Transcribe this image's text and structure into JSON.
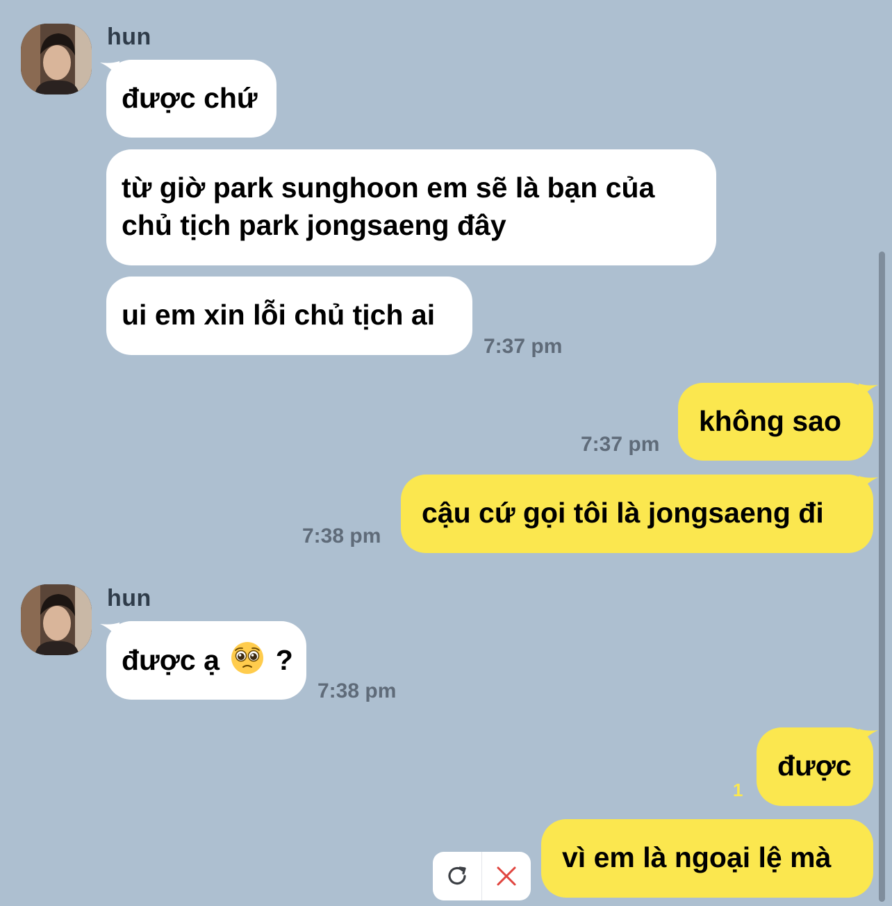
{
  "colors": {
    "background": "#adbfd0",
    "incoming_bubble": "#ffffff",
    "outgoing_bubble": "#fbe74f",
    "timestamp": "#5f6b79",
    "unread_count": "#fbe74f",
    "delete": "#e0453f"
  },
  "groups": [
    {
      "sender": "hun",
      "avatar_icon": "profile-photo",
      "messages": [
        {
          "text": "được chứ"
        },
        {
          "text_lines": [
            "từ giờ park sunghoon em sẽ là bạn của",
            "chủ tịch park jongsaeng đây"
          ]
        },
        {
          "text": "ui em xin lỗi chủ tịch ai",
          "time": "7:37 pm"
        }
      ]
    },
    {
      "sender": "",
      "messages": [
        {
          "text": "không sao",
          "time": "7:37 pm"
        },
        {
          "text": "cậu cứ gọi tôi là jongsaeng đi",
          "time": "7:38 pm"
        }
      ]
    },
    {
      "sender": "hun",
      "avatar_icon": "profile-photo",
      "messages": [
        {
          "text_before": "được ạ",
          "emoji": "pleading-face-emoji",
          "text_after": "?",
          "time": "7:38 pm"
        }
      ]
    },
    {
      "sender": "",
      "messages": [
        {
          "text": "được",
          "unread": "1"
        },
        {
          "text": "vì em là ngoại lệ mà",
          "status": "failed"
        }
      ]
    }
  ],
  "failed_actions": {
    "retry_icon": "retry-icon",
    "delete_icon": "close-icon"
  }
}
